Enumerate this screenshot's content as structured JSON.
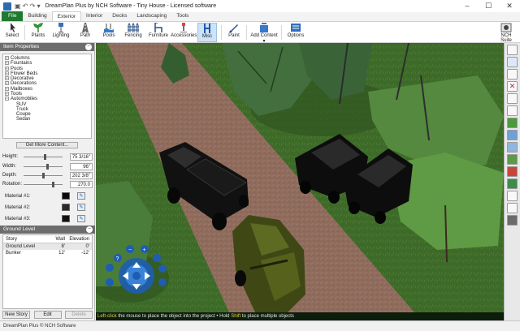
{
  "window": {
    "title": "DreamPlan Plus by NCH Software - Tiny House - Licensed software",
    "controls": [
      "minimize",
      "maximize",
      "close"
    ]
  },
  "ribbon": {
    "tabs": [
      {
        "label": "File"
      },
      {
        "label": "Building"
      },
      {
        "label": "Exterior"
      },
      {
        "label": "Interior"
      },
      {
        "label": "Decks"
      },
      {
        "label": "Landscaping"
      },
      {
        "label": "Tools"
      }
    ],
    "active_tab": "Exterior"
  },
  "toolbar": {
    "items": [
      {
        "label": "Select",
        "icon": "cursor-icon"
      },
      {
        "label": "Plants",
        "icon": "plant-icon"
      },
      {
        "label": "Lighting",
        "icon": "lamp-icon"
      },
      {
        "label": "Path",
        "icon": "path-icon"
      },
      {
        "label": "Pools",
        "icon": "pool-icon"
      },
      {
        "label": "Fencing",
        "icon": "fence-icon"
      },
      {
        "label": "Furniture",
        "icon": "chair-icon"
      },
      {
        "label": "Accessories",
        "icon": "accessory-icon"
      },
      {
        "label": "Misc",
        "icon": "misc-icon"
      },
      {
        "label": "Paint",
        "icon": "paint-icon"
      },
      {
        "label": "Add Content",
        "icon": "add-content-icon"
      },
      {
        "label": "Options",
        "icon": "options-icon"
      },
      {
        "label": "NCH Suite",
        "icon": "suite-icon"
      }
    ],
    "selected": "Misc"
  },
  "item_properties": {
    "title": "Item Properties",
    "tree": [
      {
        "label": "Columns",
        "expanded": false
      },
      {
        "label": "Fountains",
        "expanded": false
      },
      {
        "label": "Pools",
        "expanded": false
      },
      {
        "label": "Flower Beds",
        "expanded": false
      },
      {
        "label": "Decorative",
        "expanded": false
      },
      {
        "label": "Decorations",
        "expanded": false
      },
      {
        "label": "Mailboxes",
        "expanded": false
      },
      {
        "label": "Tools",
        "expanded": false
      },
      {
        "label": "Automobiles",
        "expanded": true,
        "children": [
          "SUV",
          "Truck",
          "Coupe",
          "Sedan"
        ]
      }
    ],
    "get_more_label": "Get More Content...",
    "properties": [
      {
        "label": "Height:",
        "value": "75 3/16\"",
        "slider_fraction": 0.55
      },
      {
        "label": "Width:",
        "value": "96\"",
        "slider_fraction": 0.6
      },
      {
        "label": "Depth:",
        "value": "202 3/8\"",
        "slider_fraction": 0.5
      },
      {
        "label": "Rotation:",
        "value": "270.0",
        "slider_fraction": 0.75
      }
    ],
    "materials": [
      {
        "label": "Material #1:",
        "color": "#0a0a0a"
      },
      {
        "label": "Material #2:",
        "color": "#2a2a2a"
      },
      {
        "label": "Material #3:",
        "color": "#111111"
      }
    ]
  },
  "ground_level": {
    "title": "Ground Level",
    "columns": [
      "Story",
      "Wall Height",
      "Elevation"
    ],
    "rows": [
      {
        "story": "Ground Level",
        "wall_height": "8'",
        "elevation": "0'"
      },
      {
        "story": "Bunker",
        "wall_height": "12'",
        "elevation": "-12'"
      }
    ],
    "buttons": [
      "New Story",
      "Edit",
      "Delete"
    ]
  },
  "viewport": {
    "hint_parts": [
      {
        "text": "Left-click",
        "highlight": true
      },
      {
        "text": " the mouse to place the object into the project • Hold ",
        "highlight": false
      },
      {
        "text": "Shift",
        "highlight": true
      },
      {
        "text": " to place multiple objects",
        "highlight": false
      }
    ],
    "colors": {
      "grass": "#3d6a28",
      "path": "#8f6b5c",
      "tree": "#3a6b3a"
    }
  },
  "right_sidebar": {
    "icons": [
      "hand-icon",
      "rotate-view-icon",
      "zoom-icon",
      "delete-icon",
      "copy-icon",
      "paste-icon",
      "grass-icon",
      "tree-icon",
      "layers-icon",
      "terrain-icon",
      "house-icon",
      "paint-bucket-icon",
      "ruler-icon",
      "camera-icon",
      "screen-icon"
    ]
  },
  "status": {
    "text": "DreamPlan Plus © NCH Software"
  }
}
